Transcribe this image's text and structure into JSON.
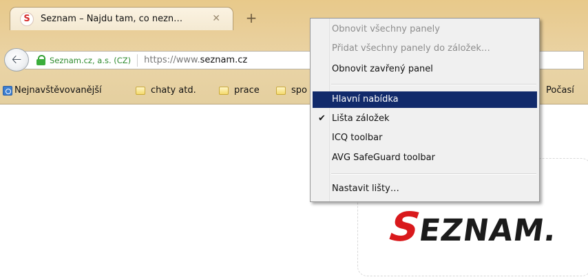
{
  "tab": {
    "favicon": "S",
    "title": "Seznam – Najdu tam, co nezn…",
    "close": "✕",
    "new_tab": "+"
  },
  "navbar": {
    "back_icon": "arrow-left-icon",
    "identity": "Seznam.cz, a.s. (CZ)",
    "url_prefix": "https://www.",
    "url_domain": "seznam.cz"
  },
  "bookmarks": [
    {
      "label": "Nejnavštěvovanější"
    },
    {
      "label": "chaty atd."
    },
    {
      "label": "prace"
    },
    {
      "label": "spo"
    },
    {
      "label": "Počasí"
    }
  ],
  "menu": {
    "items": [
      {
        "label": "Obnovit všechny panely",
        "disabled": true
      },
      {
        "label": "Přidat všechny panely do záložek…",
        "disabled": true
      },
      {
        "label": "Obnovit zavřený panel"
      },
      {
        "label": "Hlavní nabídka",
        "active": true
      },
      {
        "label": "Lišta záložek",
        "checked": true,
        "check": "✔"
      },
      {
        "label": "ICQ toolbar"
      },
      {
        "label": "AVG SafeGuard toolbar"
      },
      {
        "label": "Nastavit lišty…"
      }
    ]
  },
  "page": {
    "logo_s": "S",
    "logo_rest": "EZNAM."
  },
  "colors": {
    "menu_highlight": "#112a6b",
    "chrome": "#e9cf9b",
    "secure_green": "#2e8b2e",
    "logo_red": "#d9191c"
  }
}
